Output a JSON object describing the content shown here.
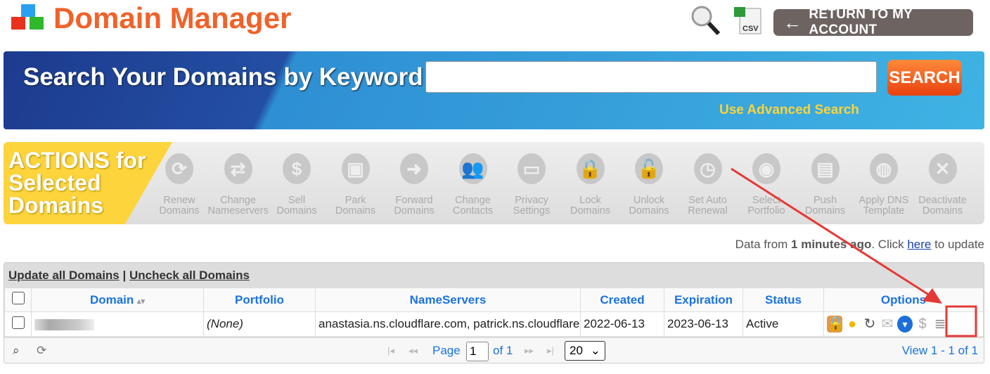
{
  "header": {
    "title": "Domain Manager",
    "return_label": "RETURN TO MY ACCOUNT",
    "csv_label": "CSV"
  },
  "banner": {
    "title": "Search Your Domains by Keyword",
    "search_value": "",
    "search_button": "SEARCH",
    "advanced_link": "Use Advanced Search"
  },
  "actions": {
    "title_lines": [
      "ACTIONS for",
      "Selected",
      "Domains"
    ],
    "items": [
      {
        "l1": "Renew",
        "l2": "Domains",
        "icon": "renew-icon",
        "g": "⟳"
      },
      {
        "l1": "Change",
        "l2": "Nameservers",
        "icon": "swap-arrows-icon",
        "g": "⇄"
      },
      {
        "l1": "Sell",
        "l2": "Domains",
        "icon": "dollar-icon",
        "g": "$"
      },
      {
        "l1": "Park",
        "l2": "Domains",
        "icon": "truck-icon",
        "g": "▣"
      },
      {
        "l1": "Forward",
        "l2": "Domains",
        "icon": "forward-arrow-icon",
        "g": "➜"
      },
      {
        "l1": "Change",
        "l2": "Contacts",
        "icon": "contacts-icon",
        "g": "👥"
      },
      {
        "l1": "Privacy",
        "l2": "Settings",
        "icon": "tag-icon",
        "g": "▭"
      },
      {
        "l1": "Lock",
        "l2": "Domains",
        "icon": "lock-icon",
        "g": "🔒"
      },
      {
        "l1": "Unlock",
        "l2": "Domains",
        "icon": "unlock-icon",
        "g": "🔓"
      },
      {
        "l1": "Set Auto",
        "l2": "Renewal",
        "icon": "clock-icon",
        "g": "◷"
      },
      {
        "l1": "Select",
        "l2": "Portfolio",
        "icon": "portfolio-disc-icon",
        "g": "◉"
      },
      {
        "l1": "Push",
        "l2": "Domains",
        "icon": "push-servers-icon",
        "g": "▤"
      },
      {
        "l1": "Apply DNS",
        "l2": "Template",
        "icon": "dns-template-icon",
        "g": "◍"
      },
      {
        "l1": "Deactivate",
        "l2": "Domains",
        "icon": "deactivate-x-icon",
        "g": "✕"
      }
    ]
  },
  "status": {
    "prefix": "Data from ",
    "bold": "1 minutes ago",
    "mid": ". Click ",
    "link": "here",
    "suffix": " to update"
  },
  "table": {
    "toolbar": {
      "update_all": "Update all Domains",
      "sep": " | ",
      "uncheck_all": "Uncheck all Domains"
    },
    "columns": [
      "Domain",
      "Portfolio",
      "NameServers",
      "Created",
      "Expiration",
      "Status",
      "Options"
    ],
    "sort_icon": "▴▾",
    "rows": [
      {
        "domain": "",
        "portfolio": "(None)",
        "nameservers": "anastasia.ns.cloudflare.com, patrick.ns.cloudflare.com",
        "created": "2022-06-13",
        "expiration": "2023-06-13",
        "status": "Active"
      }
    ],
    "options_icons": [
      "lock-icon",
      "contact-person-icon",
      "redirect-icon",
      "email-icon",
      "globe-icon",
      "dollar-icon",
      "database-icon"
    ],
    "pager": {
      "page_label": "Page",
      "page_value": "1",
      "of_label": "of 1",
      "page_size": "20",
      "view": "View 1 - 1 of 1"
    }
  },
  "colors": {
    "brand": "#f0622a",
    "link": "#1a73e0",
    "highlight": "#e53935"
  }
}
